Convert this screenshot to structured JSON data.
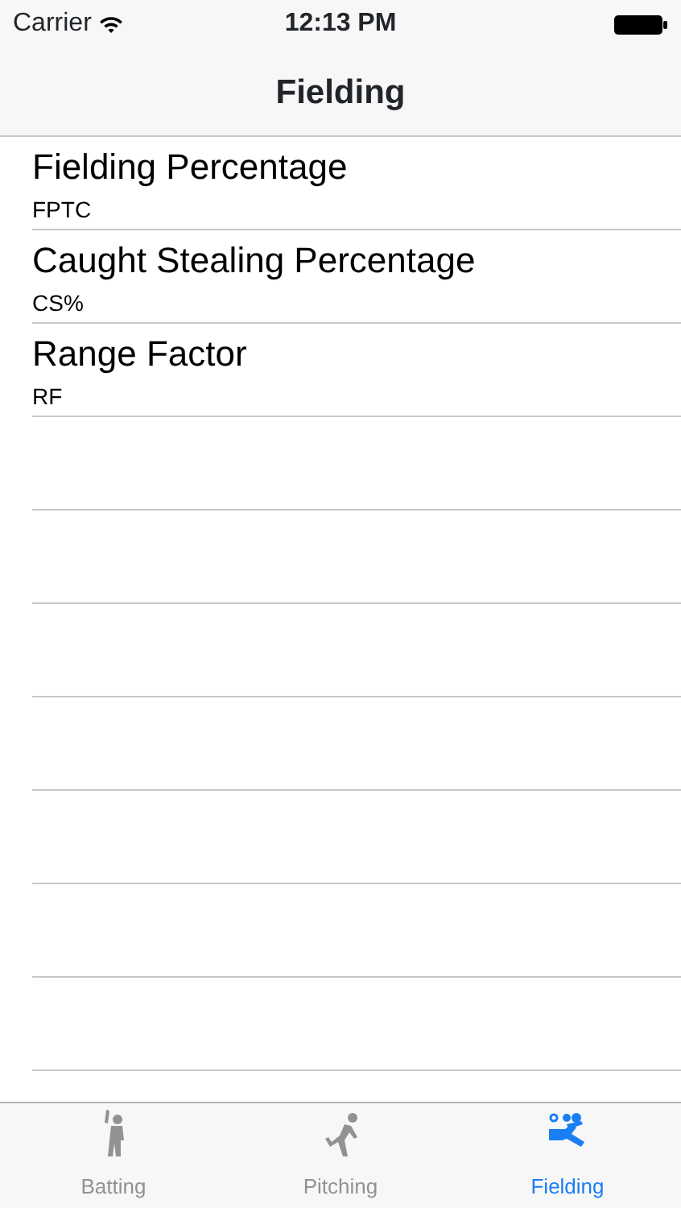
{
  "status_bar": {
    "carrier": "Carrier",
    "time": "12:13 PM"
  },
  "nav_bar": {
    "title": "Fielding"
  },
  "rows": [
    {
      "title": "Fielding Percentage",
      "subtitle": "FPTC"
    },
    {
      "title": "Caught Stealing Percentage",
      "subtitle": "CS%"
    },
    {
      "title": "Range Factor",
      "subtitle": "RF"
    }
  ],
  "tabs": [
    {
      "label": "Batting",
      "kind": "batting",
      "selected": false
    },
    {
      "label": "Pitching",
      "kind": "pitching",
      "selected": false
    },
    {
      "label": "Fielding",
      "kind": "fielding",
      "selected": true
    }
  ]
}
